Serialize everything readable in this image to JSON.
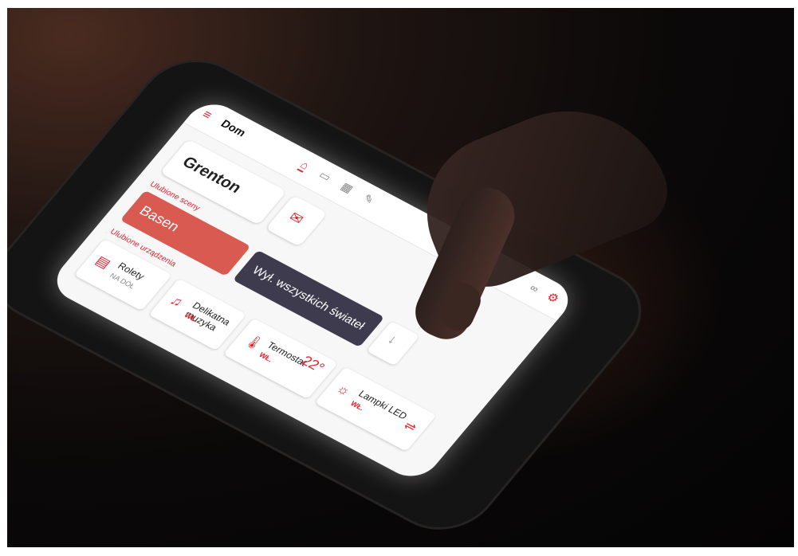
{
  "app": {
    "title": "Dom",
    "logo": "Grenton"
  },
  "header": {
    "menu_icon": "menu-icon",
    "tabs": [
      {
        "icon": "house-icon"
      },
      {
        "icon": "sofa-icon"
      },
      {
        "icon": "building-icon"
      },
      {
        "icon": "tools-icon"
      }
    ],
    "settings_icon": "gear-icon",
    "link_icon": "link-icon"
  },
  "scenes": {
    "section_label": "Ulubione sceny",
    "items": [
      {
        "label": "Basen"
      },
      {
        "label": "Wył. wszystkich świateł"
      }
    ]
  },
  "devices": {
    "section_label": "Ulubione urządzenia",
    "items": [
      {
        "name": "Rolety",
        "status": "NA DÓŁ"
      },
      {
        "name": "Delikatna muzyka",
        "status": "WŁ."
      },
      {
        "name": "Termostat",
        "status": "WŁ.",
        "value": "22°"
      },
      {
        "name": "Lampki LED",
        "status": "WŁ."
      }
    ]
  },
  "colors": {
    "accent": "#e2232e",
    "scene_basen": "#d95a50",
    "scene_lights": "#3f3b4e"
  }
}
